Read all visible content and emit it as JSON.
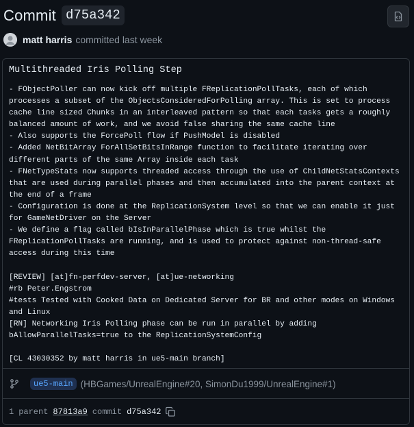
{
  "header": {
    "title_word": "Commit",
    "sha": "d75a342"
  },
  "icons": {
    "browse": "file-code-icon",
    "avatar": "user-avatar",
    "branch": "git-branch-icon",
    "copy": "copy-icon"
  },
  "author": {
    "name": "matt harris",
    "action": "committed last week"
  },
  "commit": {
    "title": "Multithreaded Iris Polling Step",
    "body": "- FObjectPoller can now kick off multiple FReplicationPollTasks, each of which\nprocesses a subset of the ObjectsConsideredForPolling array. This is set to process\ncache line sized Chunks in an interleaved pattern so that each tasks gets a roughly\nbalanced amount of work, and we avoid false sharing the same cache line\n- Also supports the ForcePoll flow if PushModel is disabled\n- Added NetBitArray ForAllSetBitsInRange function to facilitate iterating over\ndifferent parts of the same Array inside each task\n- FNetTypeStats now supports threaded access through the use of ChildNetStatsContexts\nthat are used during parallel phases and then accumulated into the parent context at\nthe end of a frame\n- Configuration is done at the ReplicationSystem level so that we can enable it just\nfor GameNetDriver on the Server\n- We define a flag called bIsInParallelPhase which is true whilst the\nFReplicationPollTasks are running, and is used to protect against non-thread-safe\naccess during this time\n\n[REVIEW] [at]fn-perfdev-server, [at]ue-networking\n#rb Peter.Engstrom\n#tests Tested with Cooked Data on Dedicated Server for BR and other modes on Windows\nand Linux\n[RN] Networking Iris Polling phase can be run in parallel by adding\nbAllowParallelTasks=true to the ReplicationSystemConfig\n\n[CL 43030352 by matt harris in ue5-main branch]"
  },
  "branch": {
    "name": "ue5-main",
    "refs": "(HBGames/UnrealEngine#20, SimonDu1999/UnrealEngine#1)"
  },
  "footer": {
    "parent_count": "1",
    "parent_label": "parent",
    "parent_sha": "87813a9",
    "commit_label": "commit",
    "commit_sha": "d75a342"
  },
  "colors": {
    "background": "#0d1117",
    "border": "#30363d",
    "muted": "#8b949e",
    "link": "#58a6ff"
  }
}
